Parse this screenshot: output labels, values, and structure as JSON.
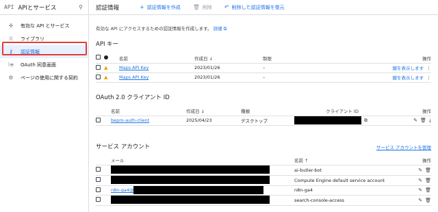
{
  "sidebar": {
    "logo": "API",
    "title": "APIとサービス",
    "items": [
      {
        "icon": "enabled-apis-icon",
        "label": "有効な API とサービス"
      },
      {
        "icon": "library-icon",
        "label": "ライブラリ"
      },
      {
        "icon": "key-icon",
        "label": "認証情報"
      },
      {
        "icon": "oauth-consent-icon",
        "label": "OAuth 同意画面"
      },
      {
        "icon": "page-usage-icon",
        "label": "ページの使用に関する契約"
      }
    ]
  },
  "toolbar": {
    "title": "認証情報",
    "create_label": "認証情報を作成",
    "delete_label": "削除",
    "restore_label": "削除した認証情報を復元"
  },
  "description": {
    "text": "有効な API にアクセスするための認証情報を作成します。",
    "link": "詳細"
  },
  "api_keys": {
    "title": "API キー",
    "headers": {
      "name": "名前",
      "created": "作成日",
      "restriction": "制限",
      "actions": "操作"
    },
    "rows": [
      {
        "name": "Maps API Key",
        "created": "2023/01/26",
        "restriction": "–",
        "action": "鍵を表示します"
      },
      {
        "name": "Maps API Key",
        "created": "2023/01/26",
        "restriction": "–",
        "action": "鍵を表示します"
      }
    ]
  },
  "oauth": {
    "title": "OAuth 2.0 クライアント ID",
    "headers": {
      "name": "名前",
      "created": "作成日",
      "type": "種類",
      "client_id": "クライアント ID",
      "actions": "操作"
    },
    "rows": [
      {
        "name": "bepro-auth-client",
        "created": "2025/04/23",
        "type": "デスクトップ"
      }
    ]
  },
  "service_accounts": {
    "title": "サービス アカウント",
    "manage_link": "サービス アカウントを管理",
    "headers": {
      "email": "メール",
      "name": "名前",
      "actions": "操作"
    },
    "rows": [
      {
        "email": "",
        "name": "ai-butler-bot"
      },
      {
        "email": "",
        "name": "Compute Engine default service account"
      },
      {
        "email": "n8n-ga4@",
        "name": "n8n-ga4"
      },
      {
        "email": "",
        "name": "search-console-access"
      }
    ]
  }
}
